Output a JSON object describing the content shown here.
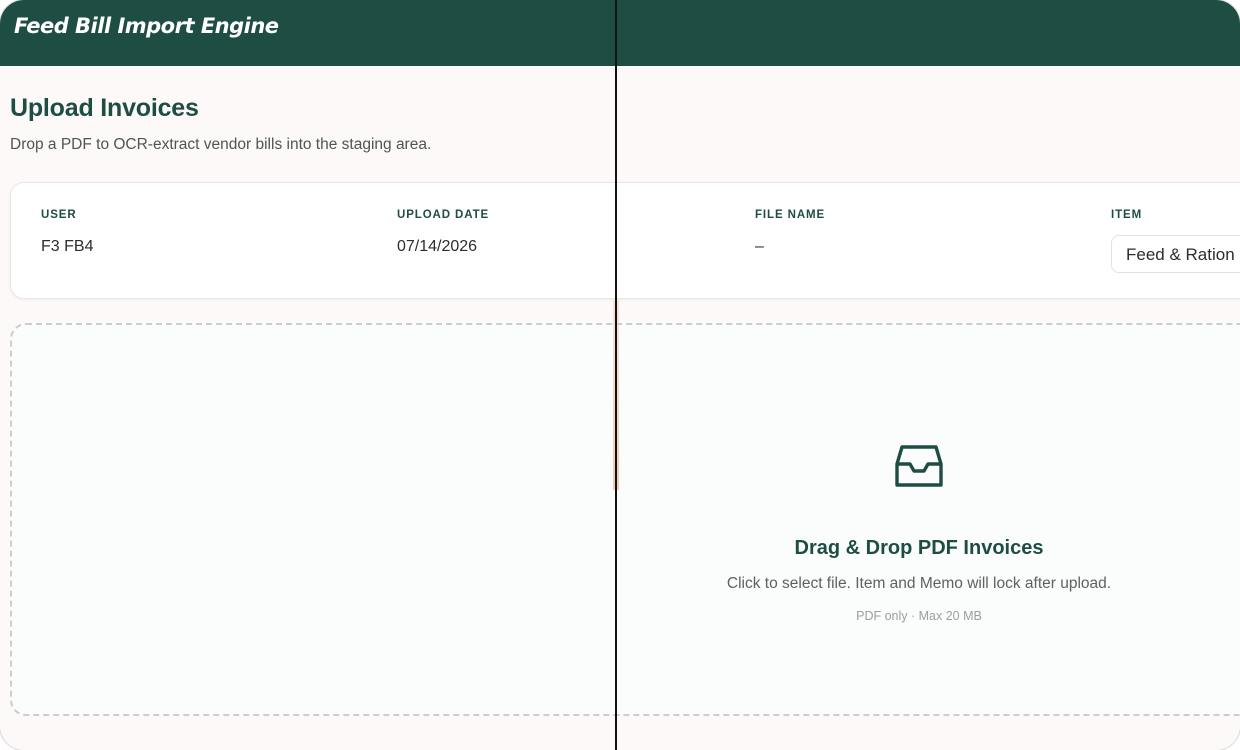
{
  "app": {
    "title": "Feed Bill Import Engine"
  },
  "page": {
    "title": "Upload Invoices",
    "subtitle": "Drop a PDF to OCR-extract vendor bills into the staging area."
  },
  "meta": {
    "user": {
      "label": "USER",
      "value": "F3 FB4"
    },
    "upload_date": {
      "label": "UPLOAD DATE",
      "value": "07/14/2026"
    },
    "file_name": {
      "label": "FILE NAME",
      "value": "–"
    },
    "item": {
      "label": "ITEM",
      "selected": "Feed & Ration"
    }
  },
  "dropzone": {
    "icon": "inbox-icon",
    "title": "Drag & Drop PDF Invoices",
    "hint": "Click to select file. Item and Memo will lock after upload.",
    "limits": "PDF only · Max 20 MB"
  },
  "colors": {
    "brand": "#1e4d44",
    "background": "#fcf9f8"
  }
}
